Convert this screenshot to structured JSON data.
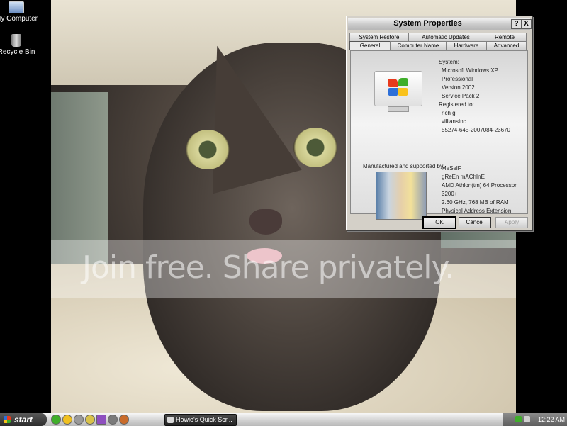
{
  "desktop": {
    "icons": [
      {
        "label": "My Computer"
      },
      {
        "label": "Recycle Bin"
      }
    ]
  },
  "wallpaper": {
    "watermark": "Join free. Share privately."
  },
  "dialog": {
    "title": "System Properties",
    "help_glyph": "?",
    "close_glyph": "X",
    "tabs_row1": [
      "System Restore",
      "Automatic Updates",
      "Remote"
    ],
    "tabs_row2": [
      "General",
      "Computer Name",
      "Hardware",
      "Advanced"
    ],
    "active_tab": "General",
    "system": {
      "heading": "System:",
      "lines": [
        "Microsoft Windows XP",
        "Professional",
        "Version 2002",
        "Service Pack 2"
      ]
    },
    "registered": {
      "heading": "Registered to:",
      "lines": [
        "rich g",
        "villiansInc",
        "55274-645-2007084-23670"
      ]
    },
    "manufacturer": {
      "heading": "Manufactured and supported by:",
      "lines": [
        "MeSelF",
        "gReEn mAChInE",
        "AMD Athlon(tm) 64 Processor",
        "3200+",
        "2.60 GHz, 768 MB of RAM",
        "Physical Address Extension"
      ]
    },
    "buttons": {
      "ok": "OK",
      "cancel": "Cancel",
      "apply": "Apply"
    }
  },
  "taskbar": {
    "start_label": "start",
    "task_button": "Howie's Quick Scr...",
    "clock": "12:22 AM"
  }
}
